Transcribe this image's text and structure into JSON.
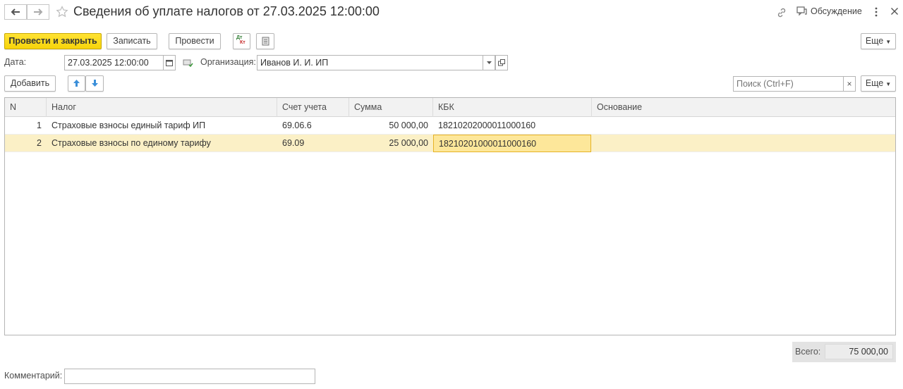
{
  "window": {
    "title": "Сведения об уплате налогов от 27.03.2025 12:00:00",
    "discussion_label": "Обсуждение"
  },
  "toolbar": {
    "post_and_close": "Провести и закрыть",
    "save": "Записать",
    "post": "Провести",
    "dt_kt_top": "Дт",
    "dt_kt_bottom": "Кт",
    "more": "Еще"
  },
  "form": {
    "date_label": "Дата:",
    "date_value": "27.03.2025 12:00:00",
    "org_label": "Организация:",
    "org_value": "Иванов И. И. ИП"
  },
  "table_toolbar": {
    "add": "Добавить",
    "search_placeholder": "Поиск (Ctrl+F)",
    "more": "Еще",
    "clear": "×"
  },
  "table": {
    "columns": [
      "N",
      "Налог",
      "Счет учета",
      "Сумма",
      "КБК",
      "Основание"
    ],
    "rows": [
      {
        "n": "1",
        "tax": "Страховые взносы единый тариф ИП",
        "account": "69.06.6",
        "sum": "50 000,00",
        "kbk": "18210202000011000160",
        "basis": ""
      },
      {
        "n": "2",
        "tax": "Страховые взносы по единому тарифу",
        "account": "69.09",
        "sum": "25 000,00",
        "kbk": "18210201000011000160",
        "basis": ""
      }
    ],
    "selected_row": 2
  },
  "footer": {
    "total_label": "Всего:",
    "total_value": "75 000,00",
    "comment_label": "Комментарий:",
    "comment_value": ""
  },
  "colors": {
    "primary_button": "#f7d40a",
    "selected_row": "#fbf0c6",
    "active_cell": "#fde79a",
    "arrow_icon": "#3b8fd9"
  },
  "icons": [
    "back-arrow-icon",
    "forward-arrow-icon",
    "star-icon",
    "link-icon",
    "discussion-icon",
    "kebab-menu-icon",
    "close-icon",
    "dt-kt-icon",
    "document-icon",
    "calendar-icon",
    "org-icon",
    "dropdown-icon",
    "open-form-icon",
    "move-up-icon",
    "move-down-icon"
  ]
}
